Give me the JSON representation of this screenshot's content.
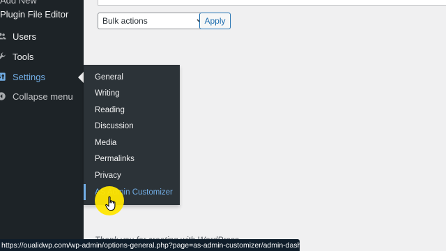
{
  "sidebar": {
    "add_new": "Add New",
    "plugin_file_editor": "Plugin File Editor",
    "items": [
      {
        "label": "Users",
        "icon": "users-icon"
      },
      {
        "label": "Tools",
        "icon": "wrench-icon"
      },
      {
        "label": "Settings",
        "icon": "settings-icon",
        "active": true
      },
      {
        "label": "Collapse menu",
        "icon": "collapse-icon"
      }
    ]
  },
  "main": {
    "bulk_actions": {
      "selected": "Bulk actions"
    },
    "apply_label": "Apply",
    "footer_thanks": "Thank you for creating with WordPress."
  },
  "settings_flyout": {
    "items": [
      {
        "label": "General"
      },
      {
        "label": "Writing"
      },
      {
        "label": "Reading"
      },
      {
        "label": "Discussion"
      },
      {
        "label": "Media"
      },
      {
        "label": "Permalinks"
      },
      {
        "label": "Privacy"
      },
      {
        "label": "AS Admin Customizer",
        "hovered": true
      }
    ]
  },
  "status_bar": {
    "url": "https://oualidwp.com/wp-admin/options-general.php?page=as-admin-customizer/admin-dashb..."
  },
  "colors": {
    "sidebar_bg": "#1d2327",
    "flyout_bg": "#2c3338",
    "accent": "#72aee6",
    "link_blue": "#2271b1",
    "cursor_halo": "#ffe600"
  }
}
